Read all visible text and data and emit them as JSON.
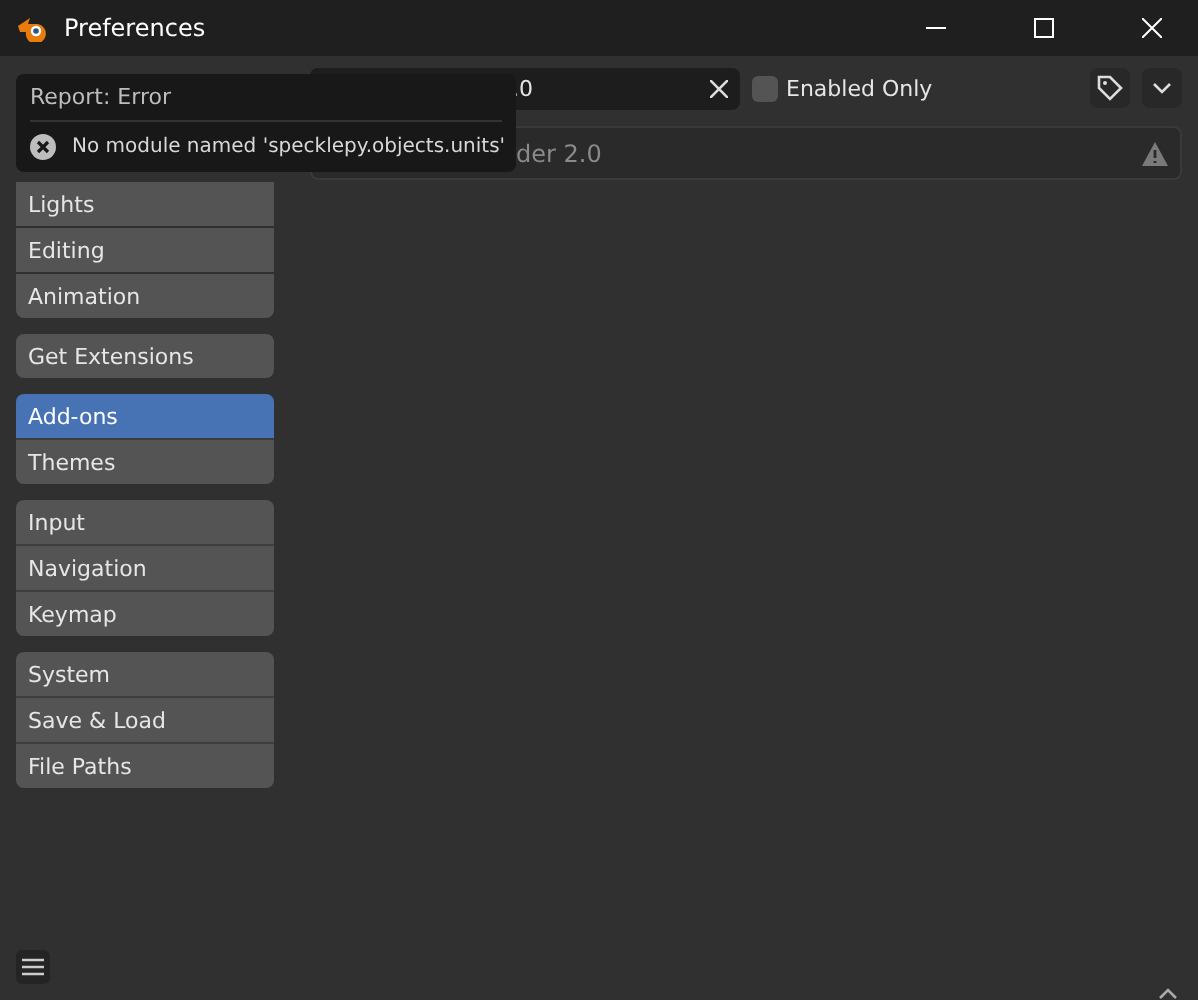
{
  "window": {
    "title": "Preferences"
  },
  "search": {
    "value": ".0"
  },
  "enabled_only": {
    "label": "Enabled Only",
    "checked": false
  },
  "banner": {
    "text": "der 2.0"
  },
  "sidebar": {
    "groups": [
      {
        "items": [
          {
            "label": "Lights",
            "selected": false
          },
          {
            "label": "Editing",
            "selected": false
          },
          {
            "label": "Animation",
            "selected": false
          }
        ]
      },
      {
        "items": [
          {
            "label": "Get Extensions",
            "selected": false
          }
        ]
      },
      {
        "items": [
          {
            "label": "Add-ons",
            "selected": true
          },
          {
            "label": "Themes",
            "selected": false
          }
        ]
      },
      {
        "items": [
          {
            "label": "Input",
            "selected": false
          },
          {
            "label": "Navigation",
            "selected": false
          },
          {
            "label": "Keymap",
            "selected": false
          }
        ]
      },
      {
        "items": [
          {
            "label": "System",
            "selected": false
          },
          {
            "label": "Save & Load",
            "selected": false
          },
          {
            "label": "File Paths",
            "selected": false
          }
        ]
      }
    ]
  },
  "report": {
    "title": "Report: Error",
    "message": "No module named 'specklepy.objects.units'"
  }
}
